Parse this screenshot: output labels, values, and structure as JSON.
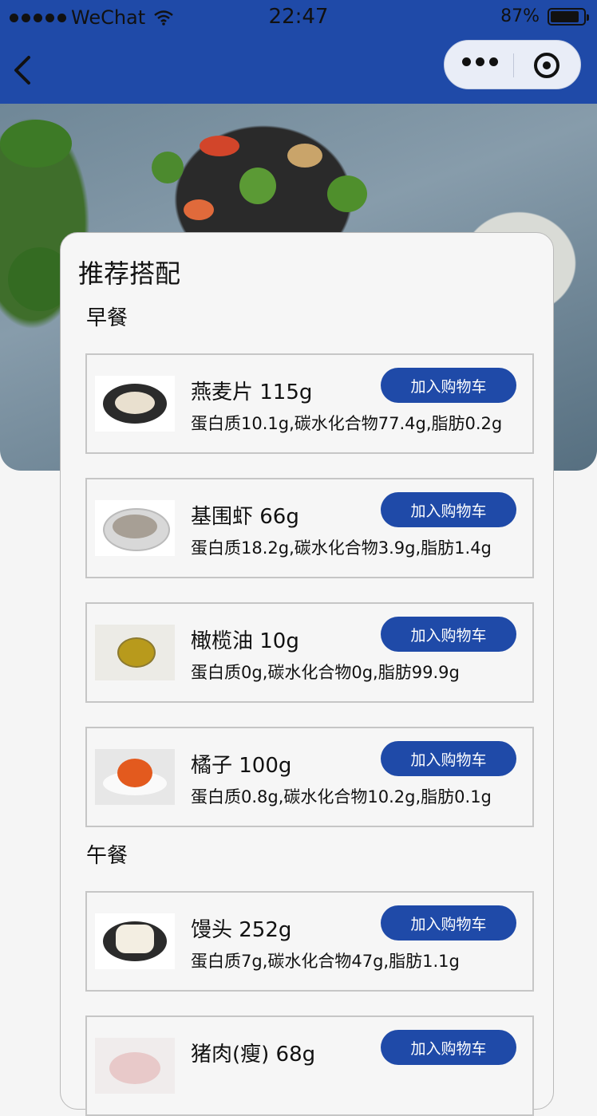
{
  "status_bar": {
    "carrier": "WeChat",
    "time": "22:47",
    "battery": "87%",
    "battery_level": 0.87
  },
  "nav": {
    "back_icon": "chevron-left-icon",
    "more_icon": "more-dots-icon",
    "close_icon": "target-circle-icon"
  },
  "colors": {
    "brand": "#1f4aa8",
    "card_bg": "#f6f6f6",
    "page_bg": "#f5f5f5"
  },
  "card": {
    "title": "推荐搭配"
  },
  "meals": [
    {
      "label": "早餐",
      "items": [
        {
          "name": "燕麦片 115g",
          "nutrition": "蛋白质10.1g,碳水化合物77.4g,脂肪0.2g",
          "button": "加入购物车"
        },
        {
          "name": "基围虾 66g",
          "nutrition": "蛋白质18.2g,碳水化合物3.9g,脂肪1.4g",
          "button": "加入购物车"
        },
        {
          "name": "橄榄油 10g",
          "nutrition": "蛋白质0g,碳水化合物0g,脂肪99.9g",
          "button": "加入购物车"
        },
        {
          "name": "橘子 100g",
          "nutrition": "蛋白质0.8g,碳水化合物10.2g,脂肪0.1g",
          "button": "加入购物车"
        }
      ]
    },
    {
      "label": "午餐",
      "items": [
        {
          "name": "馒头 252g",
          "nutrition": "蛋白质7g,碳水化合物47g,脂肪1.1g",
          "button": "加入购物车"
        },
        {
          "name": "猪肉(瘦) 68g",
          "nutrition": "",
          "button": "加入购物车"
        }
      ]
    }
  ]
}
